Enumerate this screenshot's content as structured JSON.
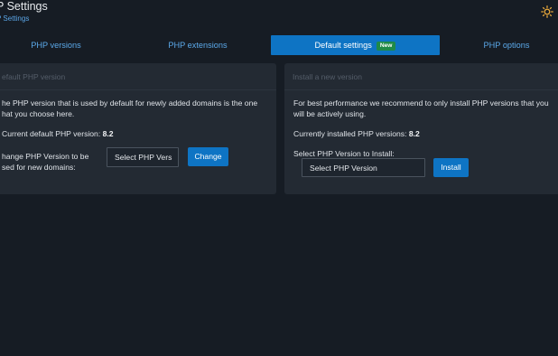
{
  "header": {
    "title": "P Settings",
    "breadcrumb": "P Settings",
    "theme_icon": "sun-icon"
  },
  "tabs": [
    {
      "label": "PHP versions",
      "active": false
    },
    {
      "label": "PHP extensions",
      "active": false
    },
    {
      "label": "Default settings",
      "active": true,
      "badge": "New"
    },
    {
      "label": "PHP options",
      "active": false
    }
  ],
  "default_card": {
    "title": "efault PHP version",
    "desc_line1": "he PHP version that is used by default for newly added domains is the one",
    "desc_line2": "hat you choose here.",
    "current_label": "Current default PHP version:",
    "current_value": "8.2",
    "change_label_line1": "hange PHP Version to be",
    "change_label_line2": "sed for new domains:",
    "select_value": "Select PHP Vers",
    "button_label": "Change"
  },
  "install_card": {
    "title": "Install a new version",
    "desc_line1": "For best performance we recommend to only install PHP versions that you",
    "desc_line2": "will be actively using.",
    "installed_label": "Currently installed PHP versions:",
    "installed_value": "8.2",
    "select_label": "Select PHP Version to Install:",
    "select_value": "Select PHP Version",
    "button_label": "Install"
  },
  "colors": {
    "background": "#161c24",
    "card": "#232a33",
    "accent": "#0e74c4",
    "badge": "#1f8a48",
    "link": "#5ba9ea"
  }
}
